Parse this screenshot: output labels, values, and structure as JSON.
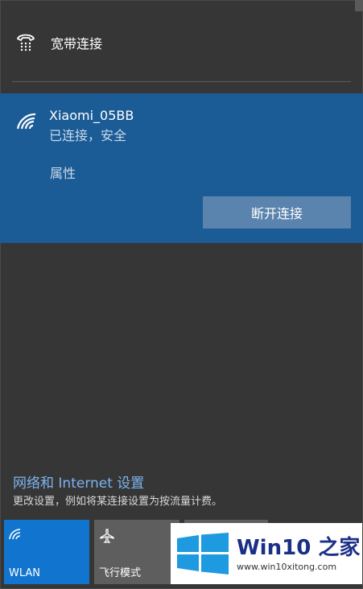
{
  "dialup": {
    "name": "宽带连接",
    "icon": "dialup-phone-icon"
  },
  "wifi": {
    "ssid": "Xiaomi_05BB",
    "status": "已连接，安全",
    "properties_label": "属性",
    "disconnect_label": "断开连接",
    "icon": "wifi-signal-icon"
  },
  "settings": {
    "link_text": "网络和 Internet 设置",
    "description": "更改设置，例如将某连接设置为按流量计费。"
  },
  "quick_actions": [
    {
      "label": "WLAN",
      "icon": "wifi-icon",
      "active": true
    },
    {
      "label": "飞行模式",
      "icon": "airplane-icon",
      "active": false
    }
  ],
  "watermark": {
    "title": "Win10 之家",
    "url": "www.win10xitong.com"
  },
  "colors": {
    "background": "#363636",
    "wifi_card": "#1b5c96",
    "wlan_tile": "#1175cf",
    "link": "#7db4f0"
  }
}
